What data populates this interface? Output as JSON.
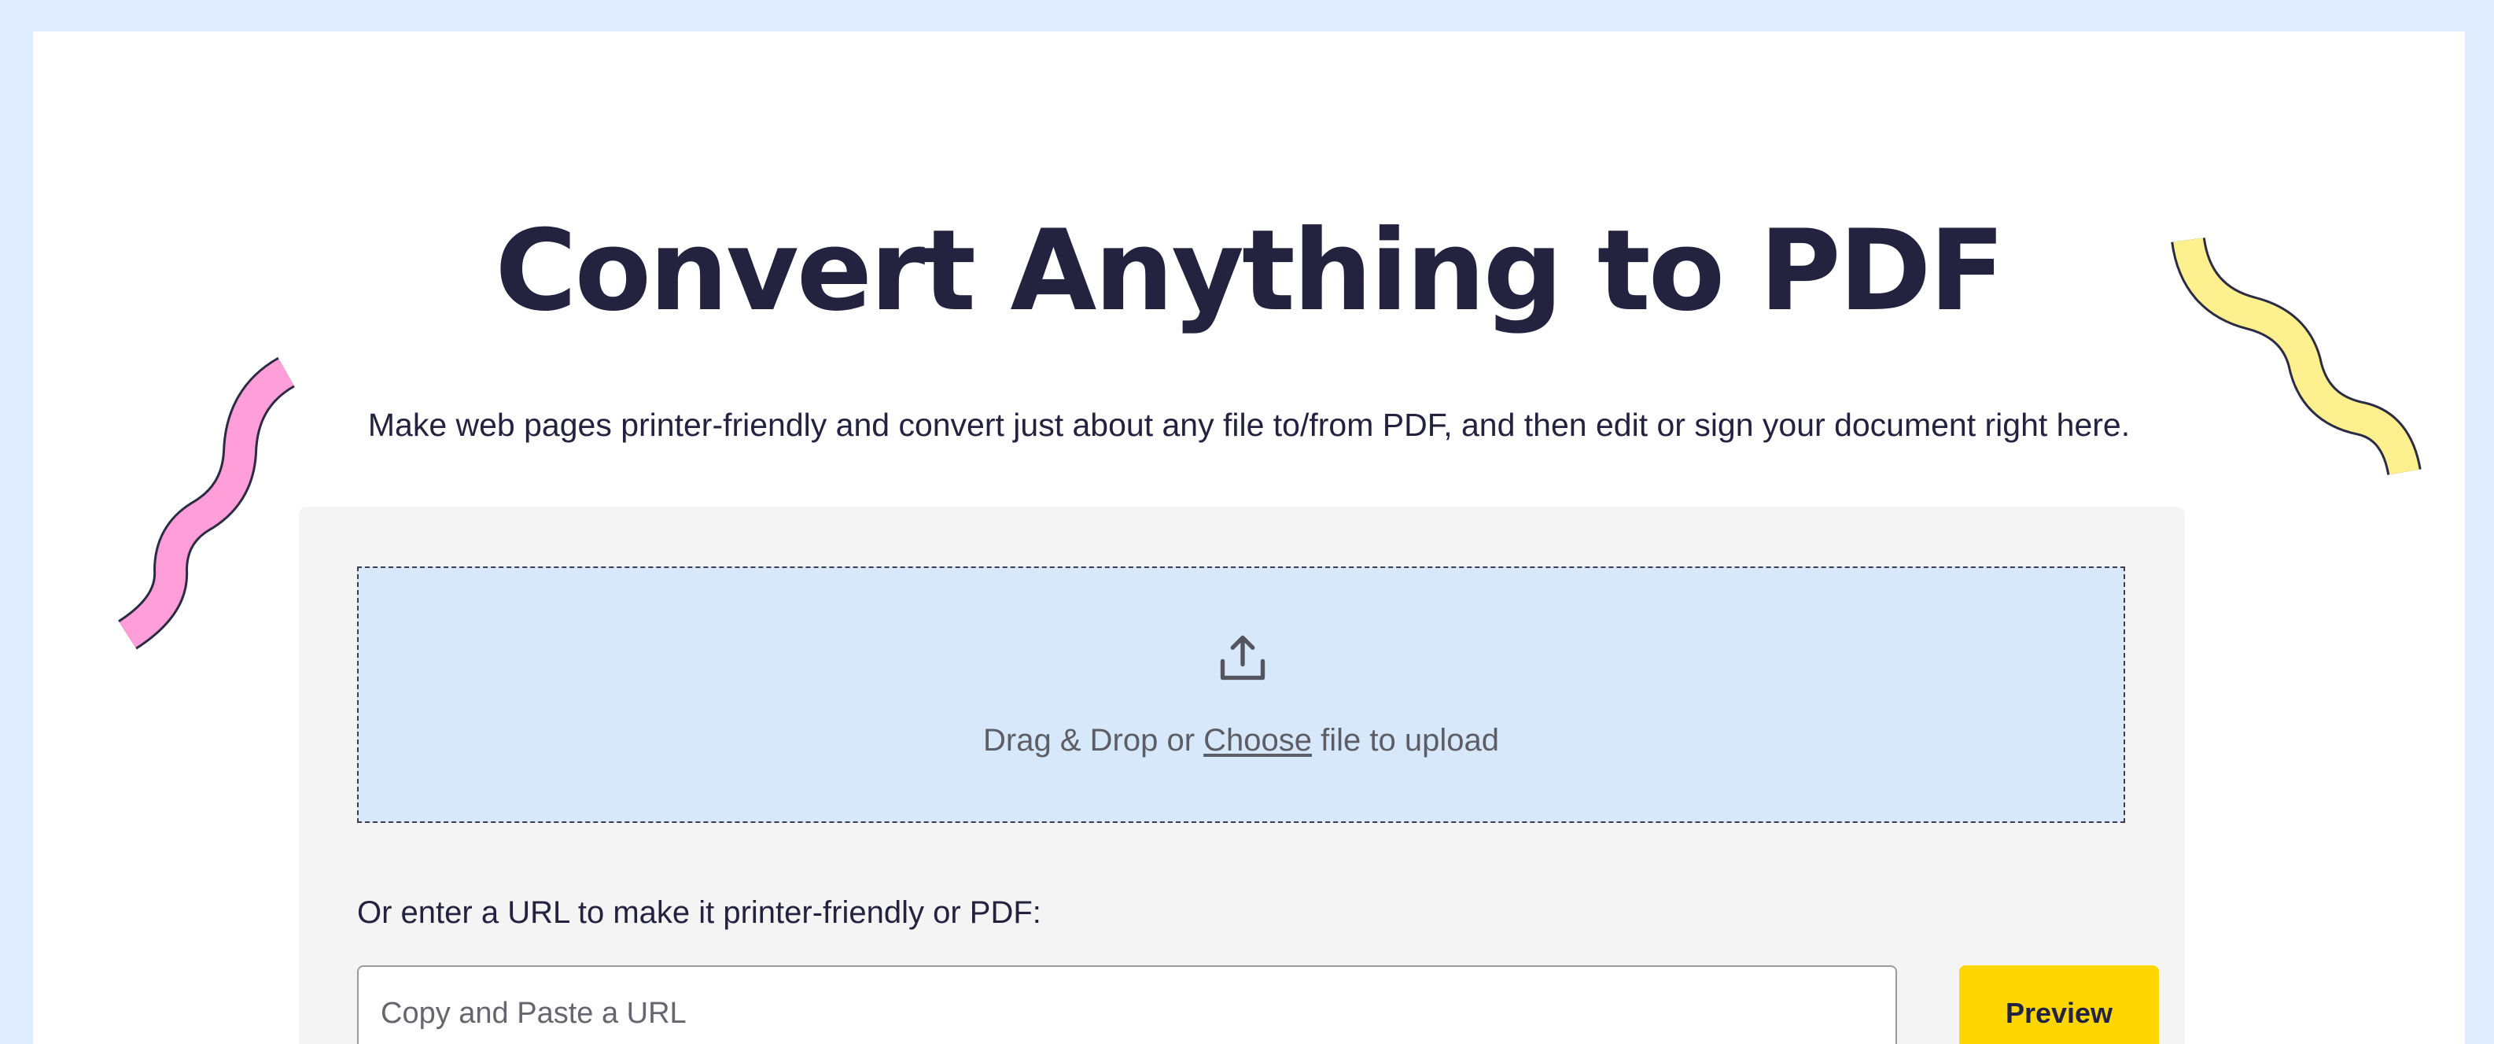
{
  "hero": {
    "title": "Convert Anything to PDF",
    "subtitle": "Make web pages printer-friendly and convert just about any file to/from PDF, and then edit or sign your document right here."
  },
  "upload": {
    "icon": "upload-icon",
    "text_before": "Drag & Drop or ",
    "choose_label": "Choose",
    "text_after": " file to upload"
  },
  "url_form": {
    "label": "Or enter a URL to make it printer-friendly or PDF:",
    "input_value": "",
    "input_placeholder": "Copy and Paste a URL",
    "preview_label": "Preview"
  },
  "decorations": {
    "left_squiggle_color": "#ff9ed8",
    "right_squiggle_color": "#fdf08f"
  },
  "colors": {
    "page_background": "#dfecfd",
    "title_text": "#23223f",
    "panel_background": "#f4f4f4",
    "dropzone_background": "#d6e8f9",
    "preview_button": "#ffd600"
  }
}
